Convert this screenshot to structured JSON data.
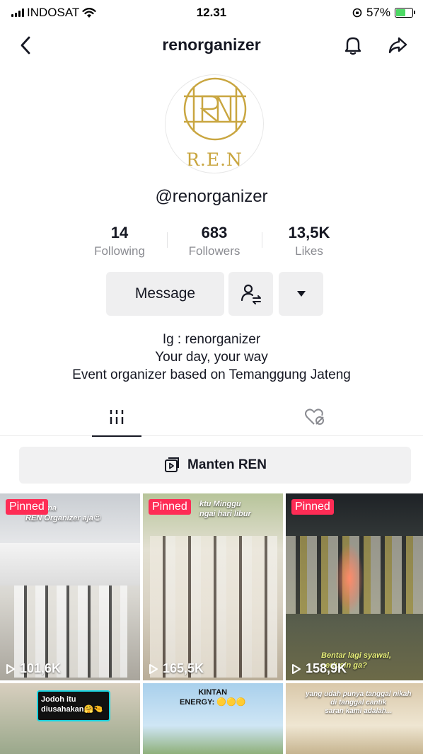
{
  "status_bar": {
    "carrier": "INDOSAT",
    "time": "12.31",
    "battery_percent": "57%",
    "battery_level": 0.57
  },
  "nav": {
    "title": "renorganizer",
    "back_icon": "chevron-left-icon",
    "bell_icon": "bell-icon",
    "share_icon": "share-arrow-icon"
  },
  "profile": {
    "avatar_text": "R.E.N",
    "username": "@renorganizer",
    "brand_color": "#c9a640"
  },
  "stats": [
    {
      "value": "14",
      "label": "Following"
    },
    {
      "value": "683",
      "label": "Followers"
    },
    {
      "value": "13,5K",
      "label": "Likes"
    }
  ],
  "actions": {
    "message_label": "Message",
    "follow_icon": "user-swap-icon",
    "more_icon": "caret-down-icon"
  },
  "bio": {
    "line1": "Ig : renorganizer",
    "line2": "Your day, your way",
    "line3": "Event organizer based on Temanggung Jateng"
  },
  "tabs": [
    {
      "icon": "grid-icon",
      "active": true
    },
    {
      "icon": "liked-hidden-icon",
      "active": false
    }
  ],
  "playlist": {
    "label": "Manten REN",
    "icon": "playlist-icon"
  },
  "videos": [
    {
      "pinned": "Pinned",
      "views": "101,6K",
      "caption": "uk sama\nREN Organizer aja😍"
    },
    {
      "pinned": "Pinned",
      "views": "165,5K",
      "caption": "ktu Minggu\nngai hari libur"
    },
    {
      "pinned": "Pinned",
      "views": "158,9K",
      "caption": "Bentar lagi syawal,\nseriusin ga?"
    },
    {
      "pinned": "",
      "views": "",
      "caption": "Jodoh itu\ndiusahakan🤗🤏"
    },
    {
      "pinned": "",
      "views": "",
      "caption": "KINTAN\nENERGY: 🟡🟡🟡"
    },
    {
      "pinned": "",
      "views": "",
      "caption": "yang udah punya tanggal nikah\ndi tanggal cantik\nsaran kami adalah..."
    }
  ],
  "colors": {
    "accent": "#fe2c55",
    "text": "#161823",
    "muted": "#8a8b91"
  }
}
